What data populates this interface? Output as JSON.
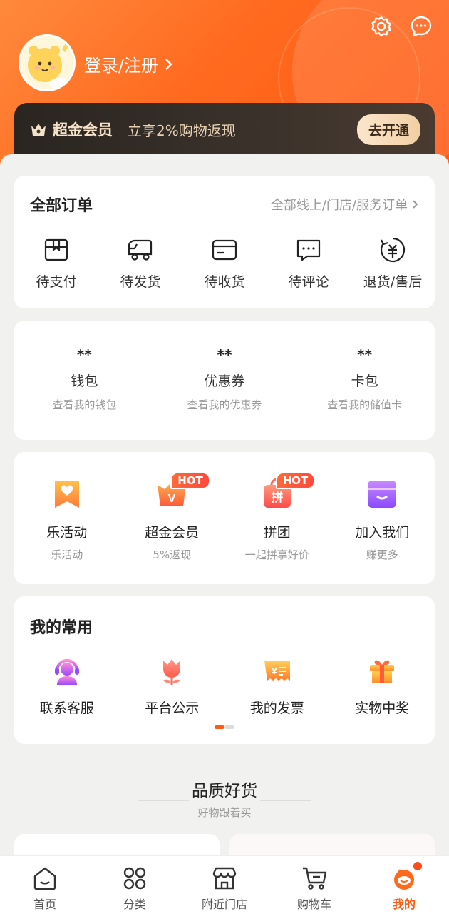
{
  "header": {
    "login_text": "登录/注册",
    "icons": [
      "settings-icon",
      "message-icon"
    ]
  },
  "member": {
    "title": "超金会员",
    "desc": "立享2%购物返现",
    "button": "去开通"
  },
  "orders": {
    "title": "全部订单",
    "link": "全部线上/门店/服务订单",
    "items": [
      {
        "label": "待支付",
        "icon": "box-icon"
      },
      {
        "label": "待发货",
        "icon": "truck-icon"
      },
      {
        "label": "待收货",
        "icon": "card-icon"
      },
      {
        "label": "待评论",
        "icon": "comment-icon"
      },
      {
        "label": "退货/售后",
        "icon": "refund-icon"
      }
    ]
  },
  "wallet": {
    "items": [
      {
        "value": "**",
        "name": "钱包",
        "sub": "查看我的钱包"
      },
      {
        "value": "**",
        "name": "优惠券",
        "sub": "查看我的优惠券"
      },
      {
        "value": "**",
        "name": "卡包",
        "sub": "查看我的储值卡"
      }
    ]
  },
  "services": {
    "hot_label": "HOT",
    "items": [
      {
        "name": "乐活动",
        "sub": "乐活动",
        "icon": "heart-bookmark-icon"
      },
      {
        "name": "超金会员",
        "sub": "5%返现",
        "icon": "vip-icon"
      },
      {
        "name": "拼团",
        "sub": "一起拼享好价",
        "icon": "group-buy-icon"
      },
      {
        "name": "加入我们",
        "sub": "赚更多",
        "icon": "store-icon"
      }
    ],
    "group_icon_text": "拼",
    "vip_icon_text": "V"
  },
  "frequent": {
    "title": "我的常用",
    "items": [
      {
        "name": "联系客服",
        "icon": "headset-icon"
      },
      {
        "name": "平台公示",
        "icon": "flower-icon"
      },
      {
        "name": "我的发票",
        "icon": "invoice-icon"
      },
      {
        "name": "实物中奖",
        "icon": "gift-icon"
      }
    ]
  },
  "quality": {
    "title": "品质好货",
    "sub": "好物跟着买"
  },
  "tabbar": {
    "items": [
      {
        "label": "首页",
        "icon": "home-icon"
      },
      {
        "label": "分类",
        "icon": "category-icon"
      },
      {
        "label": "附近门店",
        "icon": "shop-icon"
      },
      {
        "label": "购物车",
        "icon": "cart-icon"
      },
      {
        "label": "我的",
        "icon": "mine-icon"
      }
    ]
  },
  "colors": {
    "accent": "#ff5a14",
    "member_bg": "#2a2520"
  }
}
